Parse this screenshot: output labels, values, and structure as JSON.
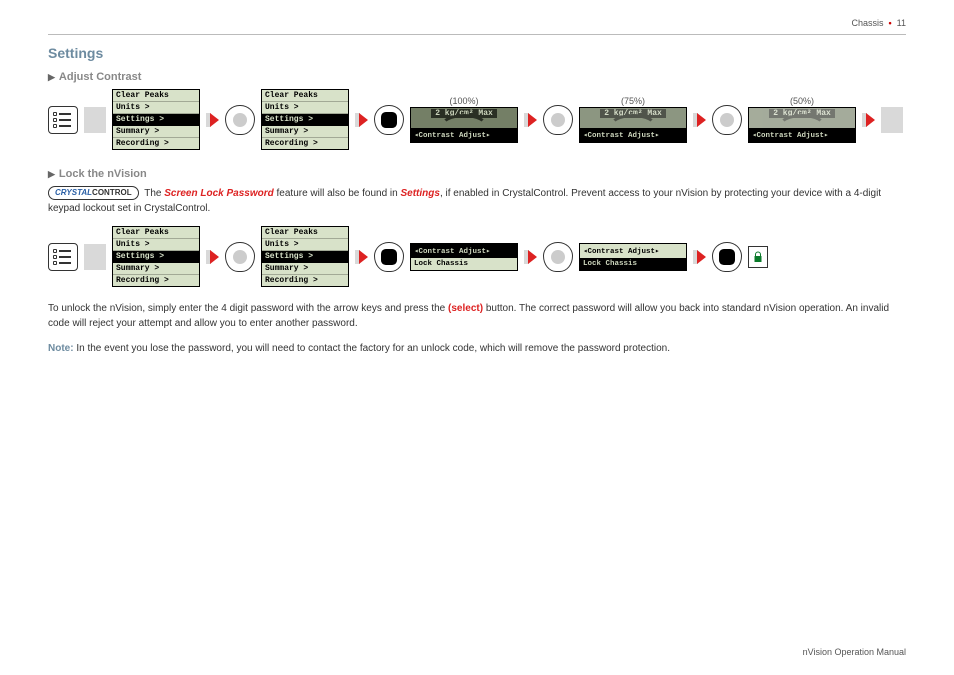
{
  "header": {
    "section": "Chassis",
    "page": "11"
  },
  "title": "Settings",
  "sub1": "Adjust Contrast",
  "sub2": "Lock the nVision",
  "menu": {
    "items": [
      "Clear Peaks",
      "Units >",
      "Settings >",
      "Summary >",
      "Recording >"
    ],
    "selected_index": 2
  },
  "contrast": {
    "pct100": "(100%)",
    "pct75": "(75%)",
    "pct50": "(50%)",
    "top_label": "2 kg/cm² Max",
    "bottom_label": "◂Contrast Adjust▸"
  },
  "lock_menu": {
    "line1": "◂Contrast Adjust▸",
    "line2": "Lock Chassis",
    "line1b": "◂Contrast Adjust▸",
    "line2b_sel": "Lock Chassis"
  },
  "para1a": "The ",
  "para1_feature": "Screen Lock Password",
  "para1b": " feature will also be found in ",
  "para1_settings": "Settings",
  "para1c": ", if enabled in CrystalControl. Prevent access to your nVision by protecting your device with a 4-digit keypad lockout set in CrystalControl.",
  "para2a": "To unlock the nVision, simply enter the 4 digit password with the arrow keys and press the ",
  "para2_btn": "(select)",
  "para2b": " button. The correct password will allow you back into standard nVision operation. An invalid code will reject your attempt and allow you to enter another password.",
  "note_label": "Note:",
  "note_text": "  In the event you lose the password, you will need to contact the factory for an unlock code, which will remove the password protection.",
  "cc_badge": {
    "p1": "CRYSTAL",
    "p2": "CONTROL"
  },
  "footer": "nVision Operation Manual"
}
